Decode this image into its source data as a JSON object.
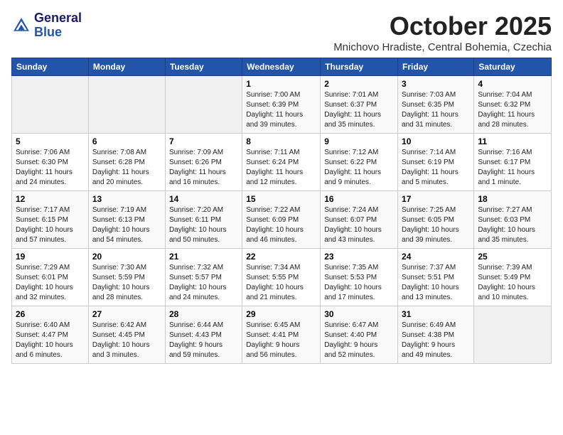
{
  "logo": {
    "line1": "General",
    "line2": "Blue"
  },
  "title": "October 2025",
  "location": "Mnichovo Hradiste, Central Bohemia, Czechia",
  "days_of_week": [
    "Sunday",
    "Monday",
    "Tuesday",
    "Wednesday",
    "Thursday",
    "Friday",
    "Saturday"
  ],
  "weeks": [
    [
      {
        "day": "",
        "info": ""
      },
      {
        "day": "",
        "info": ""
      },
      {
        "day": "",
        "info": ""
      },
      {
        "day": "1",
        "info": "Sunrise: 7:00 AM\nSunset: 6:39 PM\nDaylight: 11 hours\nand 39 minutes."
      },
      {
        "day": "2",
        "info": "Sunrise: 7:01 AM\nSunset: 6:37 PM\nDaylight: 11 hours\nand 35 minutes."
      },
      {
        "day": "3",
        "info": "Sunrise: 7:03 AM\nSunset: 6:35 PM\nDaylight: 11 hours\nand 31 minutes."
      },
      {
        "day": "4",
        "info": "Sunrise: 7:04 AM\nSunset: 6:32 PM\nDaylight: 11 hours\nand 28 minutes."
      }
    ],
    [
      {
        "day": "5",
        "info": "Sunrise: 7:06 AM\nSunset: 6:30 PM\nDaylight: 11 hours\nand 24 minutes."
      },
      {
        "day": "6",
        "info": "Sunrise: 7:08 AM\nSunset: 6:28 PM\nDaylight: 11 hours\nand 20 minutes."
      },
      {
        "day": "7",
        "info": "Sunrise: 7:09 AM\nSunset: 6:26 PM\nDaylight: 11 hours\nand 16 minutes."
      },
      {
        "day": "8",
        "info": "Sunrise: 7:11 AM\nSunset: 6:24 PM\nDaylight: 11 hours\nand 12 minutes."
      },
      {
        "day": "9",
        "info": "Sunrise: 7:12 AM\nSunset: 6:22 PM\nDaylight: 11 hours\nand 9 minutes."
      },
      {
        "day": "10",
        "info": "Sunrise: 7:14 AM\nSunset: 6:19 PM\nDaylight: 11 hours\nand 5 minutes."
      },
      {
        "day": "11",
        "info": "Sunrise: 7:16 AM\nSunset: 6:17 PM\nDaylight: 11 hours\nand 1 minute."
      }
    ],
    [
      {
        "day": "12",
        "info": "Sunrise: 7:17 AM\nSunset: 6:15 PM\nDaylight: 10 hours\nand 57 minutes."
      },
      {
        "day": "13",
        "info": "Sunrise: 7:19 AM\nSunset: 6:13 PM\nDaylight: 10 hours\nand 54 minutes."
      },
      {
        "day": "14",
        "info": "Sunrise: 7:20 AM\nSunset: 6:11 PM\nDaylight: 10 hours\nand 50 minutes."
      },
      {
        "day": "15",
        "info": "Sunrise: 7:22 AM\nSunset: 6:09 PM\nDaylight: 10 hours\nand 46 minutes."
      },
      {
        "day": "16",
        "info": "Sunrise: 7:24 AM\nSunset: 6:07 PM\nDaylight: 10 hours\nand 43 minutes."
      },
      {
        "day": "17",
        "info": "Sunrise: 7:25 AM\nSunset: 6:05 PM\nDaylight: 10 hours\nand 39 minutes."
      },
      {
        "day": "18",
        "info": "Sunrise: 7:27 AM\nSunset: 6:03 PM\nDaylight: 10 hours\nand 35 minutes."
      }
    ],
    [
      {
        "day": "19",
        "info": "Sunrise: 7:29 AM\nSunset: 6:01 PM\nDaylight: 10 hours\nand 32 minutes."
      },
      {
        "day": "20",
        "info": "Sunrise: 7:30 AM\nSunset: 5:59 PM\nDaylight: 10 hours\nand 28 minutes."
      },
      {
        "day": "21",
        "info": "Sunrise: 7:32 AM\nSunset: 5:57 PM\nDaylight: 10 hours\nand 24 minutes."
      },
      {
        "day": "22",
        "info": "Sunrise: 7:34 AM\nSunset: 5:55 PM\nDaylight: 10 hours\nand 21 minutes."
      },
      {
        "day": "23",
        "info": "Sunrise: 7:35 AM\nSunset: 5:53 PM\nDaylight: 10 hours\nand 17 minutes."
      },
      {
        "day": "24",
        "info": "Sunrise: 7:37 AM\nSunset: 5:51 PM\nDaylight: 10 hours\nand 13 minutes."
      },
      {
        "day": "25",
        "info": "Sunrise: 7:39 AM\nSunset: 5:49 PM\nDaylight: 10 hours\nand 10 minutes."
      }
    ],
    [
      {
        "day": "26",
        "info": "Sunrise: 6:40 AM\nSunset: 4:47 PM\nDaylight: 10 hours\nand 6 minutes."
      },
      {
        "day": "27",
        "info": "Sunrise: 6:42 AM\nSunset: 4:45 PM\nDaylight: 10 hours\nand 3 minutes."
      },
      {
        "day": "28",
        "info": "Sunrise: 6:44 AM\nSunset: 4:43 PM\nDaylight: 9 hours\nand 59 minutes."
      },
      {
        "day": "29",
        "info": "Sunrise: 6:45 AM\nSunset: 4:41 PM\nDaylight: 9 hours\nand 56 minutes."
      },
      {
        "day": "30",
        "info": "Sunrise: 6:47 AM\nSunset: 4:40 PM\nDaylight: 9 hours\nand 52 minutes."
      },
      {
        "day": "31",
        "info": "Sunrise: 6:49 AM\nSunset: 4:38 PM\nDaylight: 9 hours\nand 49 minutes."
      },
      {
        "day": "",
        "info": ""
      }
    ]
  ]
}
